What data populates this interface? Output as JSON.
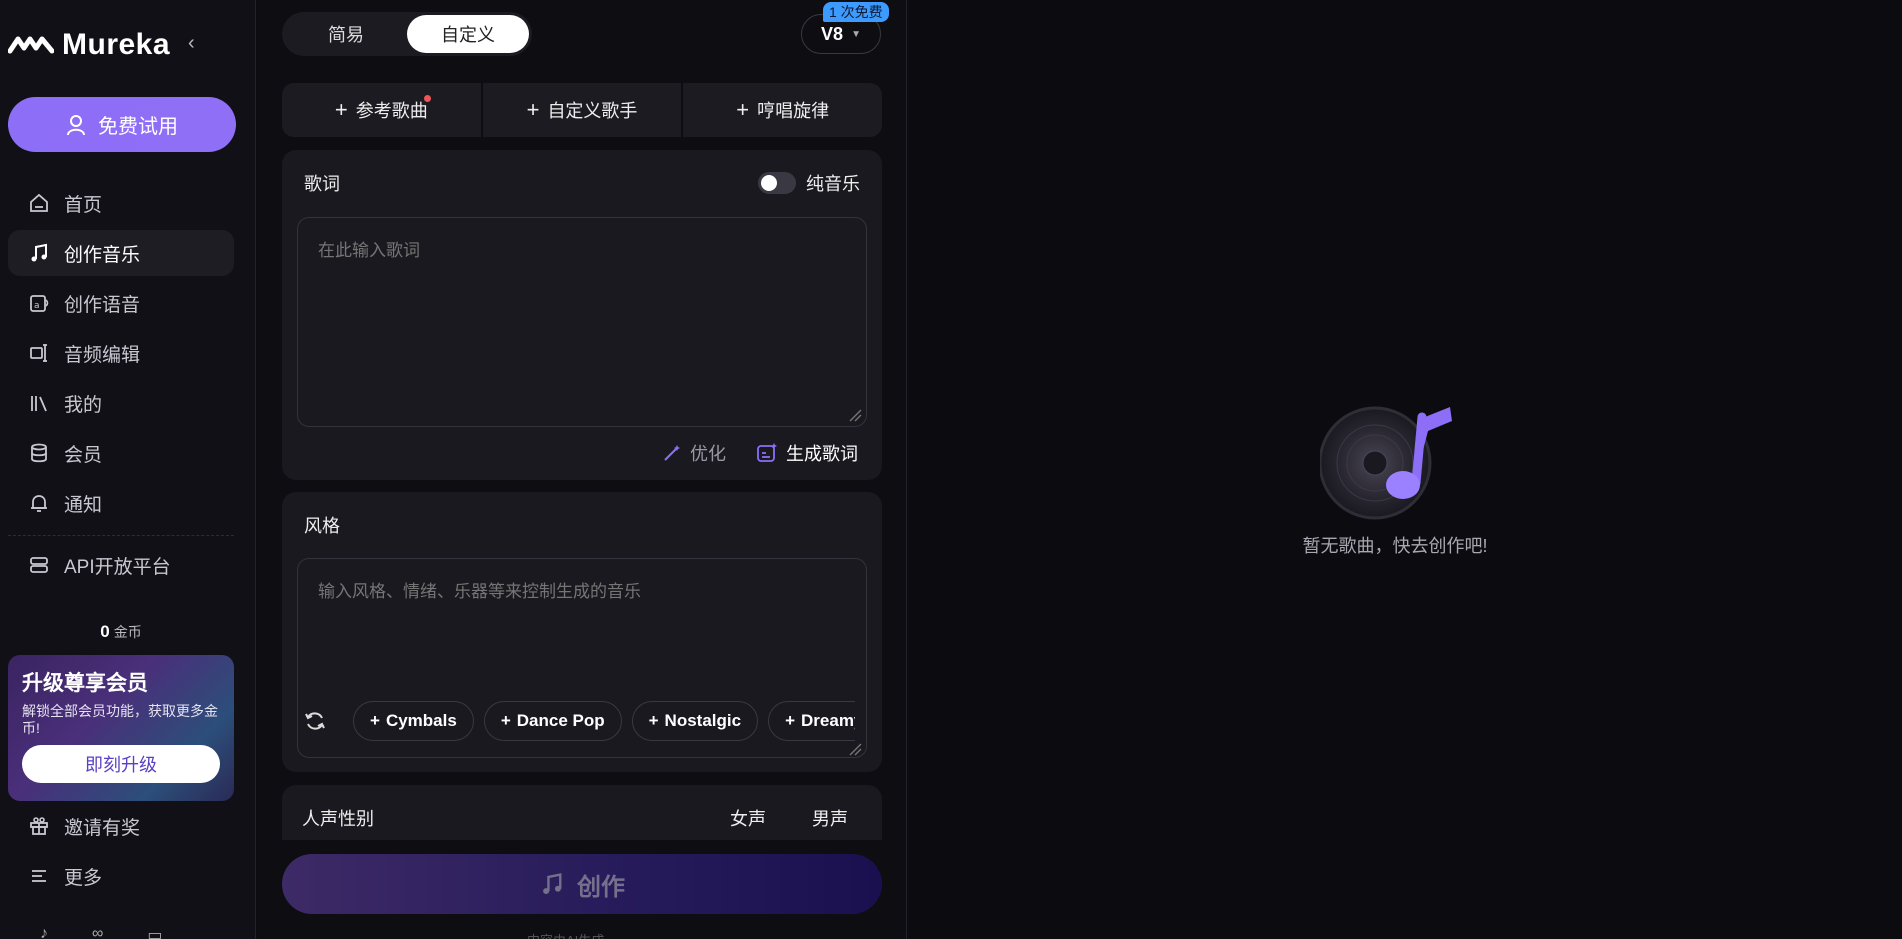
{
  "sidebar": {
    "brand": "Mureka",
    "trial_button": "免费试用",
    "nav": [
      {
        "label": "首页",
        "icon": "home-icon"
      },
      {
        "label": "创作音乐",
        "icon": "music-note-icon"
      },
      {
        "label": "创作语音",
        "icon": "voice-icon"
      },
      {
        "label": "音频编辑",
        "icon": "audio-edit-icon"
      },
      {
        "label": "我的",
        "icon": "library-icon"
      },
      {
        "label": "会员",
        "icon": "database-icon"
      },
      {
        "label": "通知",
        "icon": "bell-icon"
      }
    ],
    "api_item": "API开放平台",
    "coins": {
      "value": "0",
      "unit": "金币"
    },
    "upgrade": {
      "title": "升级尊享会员",
      "description": "解锁全部会员功能，获取更多金币!",
      "button": "即刻升级"
    },
    "bottom_nav": [
      {
        "label": "邀请有奖",
        "icon": "gift-icon"
      },
      {
        "label": "更多",
        "icon": "menu-icon"
      }
    ]
  },
  "panel": {
    "modes": [
      "简易",
      "自定义"
    ],
    "active_mode": "自定义",
    "version": "V8",
    "free_badge": "1 次免费",
    "reference_buttons": [
      "参考歌曲",
      "自定义歌手",
      "哼唱旋律"
    ],
    "lyrics": {
      "label": "歌词",
      "instrumental_label": "纯音乐",
      "placeholder": "在此输入歌词",
      "optimize": "优化",
      "generate": "生成歌词"
    },
    "style": {
      "label": "风格",
      "placeholder": "输入风格、情绪、乐器等来控制生成的音乐",
      "chips": [
        "Cymbals",
        "Dance Pop",
        "Nostalgic",
        "Dreamy"
      ]
    },
    "voice": {
      "label": "人声性别",
      "options": [
        "女声",
        "男声"
      ]
    },
    "create_button": "创作",
    "ai_note": "内容由AI生成"
  },
  "main": {
    "empty_text": "暂无歌曲，快去创作吧!"
  },
  "colors": {
    "accent": "#8d6ef7",
    "background": "#0c0b10"
  }
}
